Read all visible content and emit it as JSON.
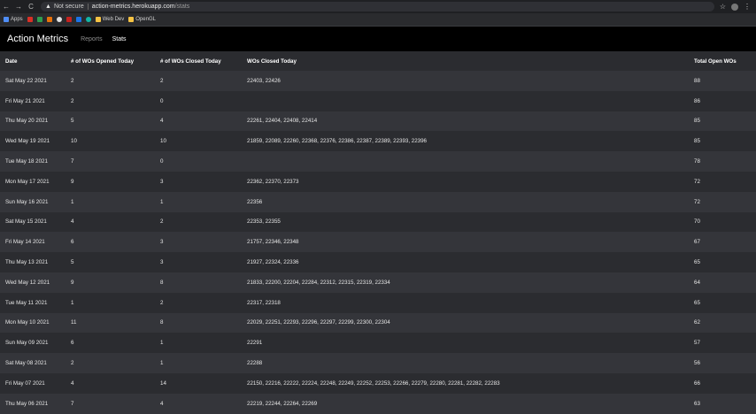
{
  "browser": {
    "nav": {
      "back": "←",
      "forward": "→",
      "reload": "C"
    },
    "security": "Not secure",
    "url_host": "action-metrics.herokuapp.com",
    "url_path": "/stats",
    "bookmarks": [
      "Apps",
      "Web Dev",
      "OpenGL"
    ]
  },
  "app": {
    "brand": "Action Metrics",
    "nav": [
      "Reports",
      "Stats"
    ]
  },
  "table": {
    "headers": [
      "Date",
      "# of WOs Opened Today",
      "# of WOs Closed Today",
      "WOs Closed Today",
      "Total Open WOs"
    ],
    "rows": [
      [
        "Sat May 22 2021",
        "2",
        "2",
        "22403, 22426",
        "88"
      ],
      [
        "Fri May 21 2021",
        "2",
        "0",
        "",
        "86"
      ],
      [
        "Thu May 20 2021",
        "5",
        "4",
        "22261, 22404, 22408, 22414",
        "85"
      ],
      [
        "Wed May 19 2021",
        "10",
        "10",
        "21859, 22089, 22260, 22368, 22376, 22386, 22387, 22389, 22393, 22396",
        "85"
      ],
      [
        "Tue May 18 2021",
        "7",
        "0",
        "",
        "78"
      ],
      [
        "Mon May 17 2021",
        "9",
        "3",
        "22362, 22370, 22373",
        "72"
      ],
      [
        "Sun May 16 2021",
        "1",
        "1",
        "22356",
        "72"
      ],
      [
        "Sat May 15 2021",
        "4",
        "2",
        "22353, 22355",
        "70"
      ],
      [
        "Fri May 14 2021",
        "6",
        "3",
        "21757, 22346, 22348",
        "67"
      ],
      [
        "Thu May 13 2021",
        "5",
        "3",
        "21927, 22324, 22336",
        "65"
      ],
      [
        "Wed May 12 2021",
        "9",
        "8",
        "21833, 22200, 22204, 22284, 22312, 22315, 22319, 22334",
        "64"
      ],
      [
        "Tue May 11 2021",
        "1",
        "2",
        "22317, 22318",
        "65"
      ],
      [
        "Mon May 10 2021",
        "11",
        "8",
        "22029, 22251, 22293, 22296, 22297, 22299, 22300, 22304",
        "62"
      ],
      [
        "Sun May 09 2021",
        "6",
        "1",
        "22291",
        "57"
      ],
      [
        "Sat May 08 2021",
        "2",
        "1",
        "22288",
        "56"
      ],
      [
        "Fri May 07 2021",
        "4",
        "14",
        "22150, 22216, 22222, 22224, 22248, 22249, 22252, 22253, 22266, 22279, 22280, 22281, 22282, 22283",
        "66"
      ],
      [
        "Thu May 06 2021",
        "7",
        "4",
        "22219, 22244, 22264, 22269",
        "63"
      ]
    ]
  }
}
